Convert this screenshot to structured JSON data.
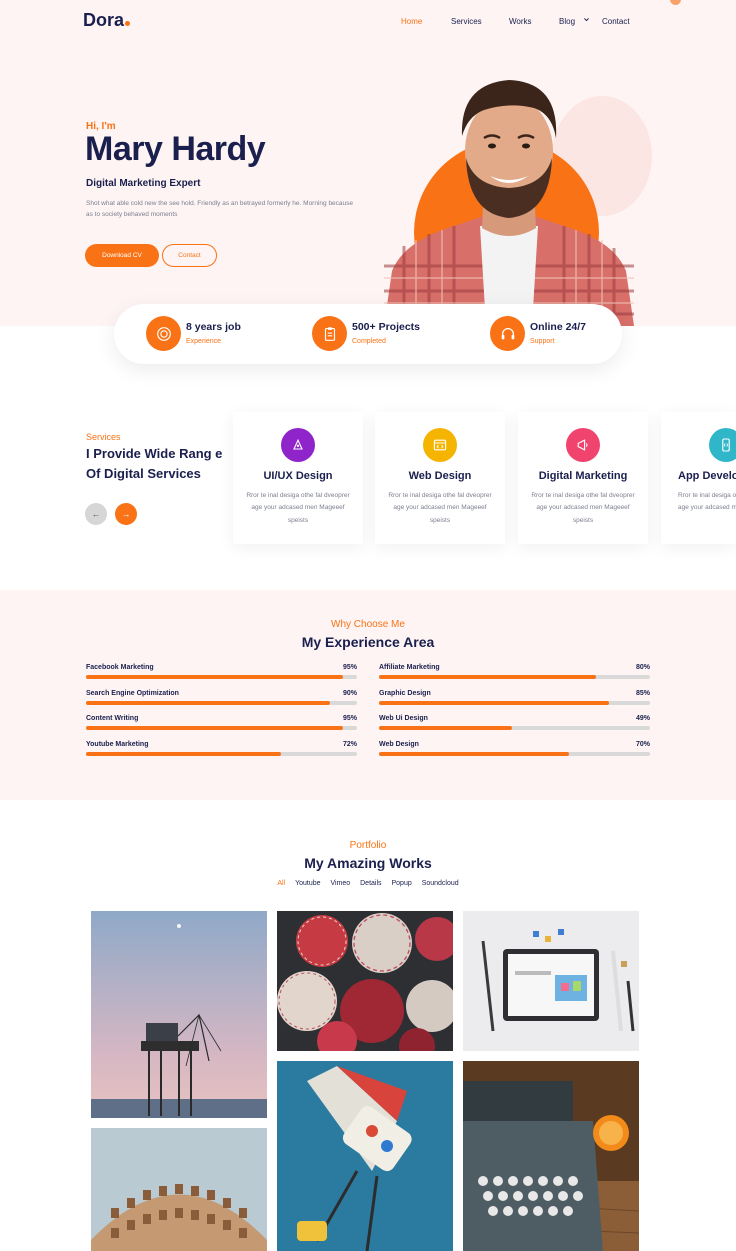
{
  "nav": {
    "logo": "Dora",
    "links": [
      {
        "label": "Home",
        "active": true
      },
      {
        "label": "Services",
        "active": false
      },
      {
        "label": "Works",
        "active": false
      },
      {
        "label": "Blog",
        "active": false
      },
      {
        "label": "Contact",
        "active": false
      }
    ]
  },
  "hero": {
    "greeting": "Hi, I'm",
    "name": "Mary Hardy",
    "role": "Digital Marketing Expert",
    "description": "Shot what able cold new the see hold. Friendly as an betrayed formerly he. Morning because as to society behaved moments",
    "cta_primary": "Download CV",
    "cta_secondary": "Contact"
  },
  "stats": [
    {
      "title": "8 years job",
      "subtitle": "Experience",
      "icon": "award-icon"
    },
    {
      "title": "500+ Projects",
      "subtitle": "Completed",
      "icon": "clipboard-icon"
    },
    {
      "title": "Online 24/7",
      "subtitle": "Support",
      "icon": "headset-icon"
    }
  ],
  "services": {
    "kicker": "Services",
    "title": "I Provide Wide Rang e Of Digital Services",
    "cards": [
      {
        "name": "UI/UX Design",
        "text": "Rror te inal desiga othe fal dveoprer age your adcased men Mageeef speists",
        "color": "#8e24c9",
        "icon": "pen-tool-icon"
      },
      {
        "name": "Web Design",
        "text": "Rror te inal desiga othe fal dveoprer age your adcased men Mageeef speists",
        "color": "#f5b400",
        "icon": "code-window-icon"
      },
      {
        "name": "Digital Marketing",
        "text": "Rror te inal desiga othe fal dveoprer age your adcased men Mageeef speists",
        "color": "#f0446e",
        "icon": "megaphone-icon"
      },
      {
        "name": "App Develo",
        "text": "Rror te inal desiga othe fal dveoprer age your adcased men Mageeef",
        "color": "#2fb7c9",
        "icon": "mobile-code-icon"
      }
    ]
  },
  "experience": {
    "kicker": "Why Choose Me",
    "title": "My Experience Area",
    "left": [
      {
        "label": "Facebook Marketing",
        "pct": "95%",
        "value": 95
      },
      {
        "label": "Search Engine Optimization",
        "pct": "90%",
        "value": 90
      },
      {
        "label": "Content Writing",
        "pct": "95%",
        "value": 95
      },
      {
        "label": "Youtube Marketing",
        "pct": "72%",
        "value": 72
      }
    ],
    "right": [
      {
        "label": "Affiliate Marketing",
        "pct": "80%",
        "value": 80
      },
      {
        "label": "Graphic Design",
        "pct": "85%",
        "value": 85
      },
      {
        "label": "Web Ui Design",
        "pct": "49%",
        "value": 49
      },
      {
        "label": "Web Design",
        "pct": "70%",
        "value": 70
      }
    ]
  },
  "portfolio": {
    "kicker": "Portfolio",
    "title": "My Amazing Works",
    "filters": [
      {
        "label": "All",
        "active": true
      },
      {
        "label": "Youtube",
        "active": false
      },
      {
        "label": "Vimeo",
        "active": false
      },
      {
        "label": "Details",
        "active": false
      },
      {
        "label": "Popup",
        "active": false
      },
      {
        "label": "Soundcloud",
        "active": false
      }
    ],
    "tiles": [
      {
        "name": "portfolio-tower-photo"
      },
      {
        "name": "portfolio-umbrellas-photo"
      },
      {
        "name": "portfolio-tablet-photo"
      },
      {
        "name": "portfolio-building-photo"
      },
      {
        "name": "portfolio-ride-photo"
      },
      {
        "name": "portfolio-typewriter-photo"
      }
    ]
  },
  "colors": {
    "accent": "#f97316",
    "navy": "#1a1f4e",
    "soft_bg": "#fdf4f3"
  }
}
